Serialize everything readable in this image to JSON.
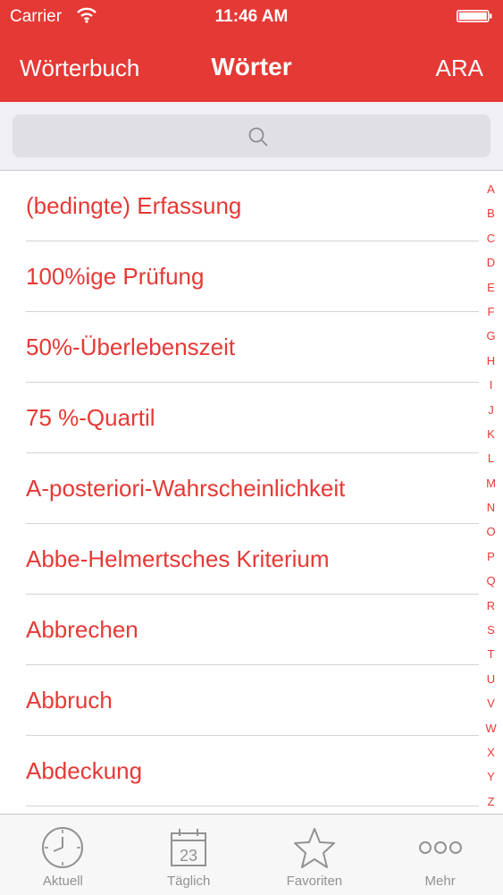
{
  "status": {
    "carrier": "Carrier",
    "time": "11:46 AM"
  },
  "nav": {
    "back": "Wörterbuch",
    "title": "Wörter",
    "right": "ARA"
  },
  "search": {
    "placeholder": ""
  },
  "words": [
    "(bedingte) Erfassung",
    "100%ige Prüfung",
    "50%-Überlebenszeit",
    "75 %-Quartil",
    "A-posteriori-Wahrscheinlichkeit",
    "Abbe-Helmertsches Kriterium",
    "Abbrechen",
    "Abbruch",
    "Abdeckung",
    ""
  ],
  "index": [
    "A",
    "B",
    "C",
    "D",
    "E",
    "F",
    "G",
    "H",
    "I",
    "J",
    "K",
    "L",
    "M",
    "N",
    "O",
    "P",
    "Q",
    "R",
    "S",
    "T",
    "U",
    "V",
    "W",
    "X",
    "Y",
    "Z"
  ],
  "tabs": [
    {
      "label": "Aktuell",
      "icon": "clock-icon"
    },
    {
      "label": "Täglich",
      "icon": "calendar-icon",
      "calendar_day": "23"
    },
    {
      "label": "Favoriten",
      "icon": "star-icon"
    },
    {
      "label": "Mehr",
      "icon": "more-icon"
    }
  ],
  "colors": {
    "accent": "#e53935",
    "tab_inactive": "#929292"
  }
}
